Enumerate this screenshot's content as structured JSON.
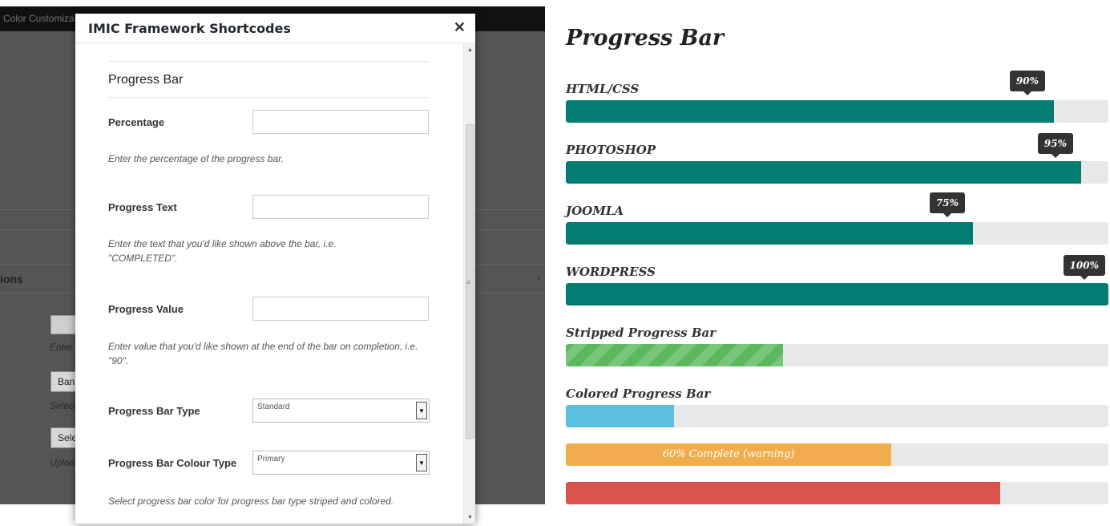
{
  "admin": {
    "bg_title": "Color Customiza",
    "section_title": "ions",
    "ghost_texts": [
      "Enter",
      "Select",
      "Uploa"
    ],
    "ghost_buttons": [
      "Ban",
      "Sele"
    ]
  },
  "modal": {
    "title": "IMIC Framework Shortcodes",
    "close_icon": "close-icon",
    "section": "Progress Bar",
    "fields": {
      "percentage": {
        "label": "Percentage",
        "value": "",
        "help": "Enter the percentage of the progress bar."
      },
      "progress_text": {
        "label": "Progress Text",
        "value": "",
        "help": "Enter the text that you'd like shown above the bar, i.e. \"COMPLETED\"."
      },
      "progress_value": {
        "label": "Progress Value",
        "value": "",
        "help": "Enter value that you'd like shown at the end of the bar on completion, i.e. \"90\"."
      },
      "bar_type": {
        "label": "Progress Bar Type",
        "selected": "Standard"
      },
      "colour_type": {
        "label": "Progress Bar Colour Type",
        "selected": "Primary",
        "help": "Select progress bar color for progress bar type striped and colored."
      }
    }
  },
  "preview": {
    "heading": "Progress Bar",
    "colors": {
      "teal": "#037c73",
      "green": "#5cb85c",
      "info": "#5bc0de",
      "warning": "#f0ad4e",
      "danger": "#d9534f",
      "track": "#e8e8e8"
    },
    "bars": [
      {
        "label": "HTML/CSS",
        "percent": 90,
        "tip": "90%"
      },
      {
        "label": "PHOTOSHOP",
        "percent": 95,
        "tip": "95%"
      },
      {
        "label": "JOOMLA",
        "percent": 75,
        "tip": "75%"
      },
      {
        "label": "WORDPRESS",
        "percent": 100,
        "tip": "100%"
      }
    ],
    "striped": {
      "label": "Stripped Progress Bar",
      "percent": 40
    },
    "colored": {
      "label": "Colored Progress Bar",
      "info_percent": 20,
      "warning_percent": 60,
      "warning_text": "60% Complete (warning)",
      "danger_percent": 80
    }
  }
}
